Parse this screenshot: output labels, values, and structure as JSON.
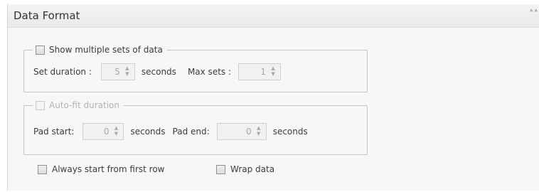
{
  "panel": {
    "title": "Data Format",
    "collapse_icon": "double-chevron-up-icon"
  },
  "multiple_sets": {
    "label": "Show multiple sets of data",
    "checked": false,
    "set_duration_label": "Set duration :",
    "set_duration_value": "5",
    "seconds_label": "seconds",
    "max_sets_label": "Max sets :",
    "max_sets_value": "1"
  },
  "auto_fit": {
    "label": "Auto-fit duration",
    "enabled": false,
    "pad_start_label": "Pad start:",
    "pad_start_value": "0",
    "seconds_label_1": "seconds",
    "pad_end_label": "Pad end:",
    "pad_end_value": "0",
    "seconds_label_2": "seconds"
  },
  "options": {
    "always_start_label": "Always start from first row",
    "wrap_data_label": "Wrap data"
  }
}
